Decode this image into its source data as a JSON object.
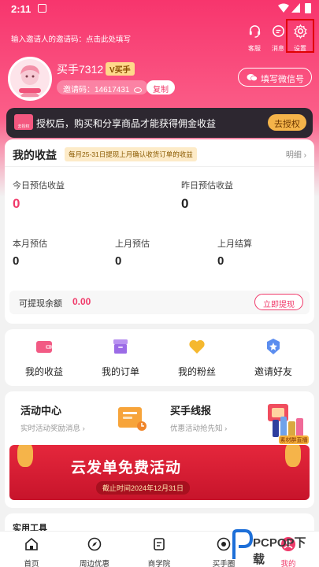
{
  "status_bar": {
    "time": "2:11"
  },
  "header": {
    "invite_tip": "输入邀请人的邀请码：点击此处填写",
    "service_label": "客服",
    "message_label": "消息",
    "settings_label": "设置"
  },
  "profile": {
    "username": "买手7312",
    "badge": "V买手",
    "invite_code_text": "邀请码：14617431",
    "copy_label": "复制",
    "wechat_label": "填写微信号"
  },
  "auth_bar": {
    "text": "授权后，购买和分享商品才能获得佣金收益",
    "button": "去授权",
    "icon_text": "去授权"
  },
  "earnings": {
    "title": "我的收益",
    "note": "每月25-31日提现上月确认收货订单的收益",
    "detail_label": "明细 ›",
    "today_label": "今日预估收益",
    "today_value": "0",
    "yesterday_label": "昨日预估收益",
    "yesterday_value": "0",
    "month_est_label": "本月预估",
    "month_est_value": "0",
    "last_month_est_label": "上月预估",
    "last_month_est_value": "0",
    "last_month_settle_label": "上月结算",
    "last_month_settle_value": "0",
    "withdrawable_label": "可提现余额",
    "withdrawable_value": "0.00",
    "withdraw_button": "立即提现"
  },
  "shortcuts": [
    {
      "label": "我的收益",
      "icon": "wallet-icon",
      "color": "#f25a84"
    },
    {
      "label": "我的订单",
      "icon": "order-box-icon",
      "color": "#9b6be6"
    },
    {
      "label": "我的粉丝",
      "icon": "heart-icon",
      "color": "#f5b82e"
    },
    {
      "label": "邀请好友",
      "icon": "star-badge-icon",
      "color": "#5b8def"
    }
  ],
  "activities": {
    "center_title": "活动中心",
    "center_sub": "实时活动奖励消息 ›",
    "report_title": "买手线报",
    "report_sub": "优惠活动抢先知 ›",
    "banner_title": "云发单免费活动",
    "banner_sub": "截止时间2024年12月31日",
    "material_tag": "素材群直播"
  },
  "tools": {
    "title": "实用工具"
  },
  "bottom_nav": [
    {
      "label": "首页",
      "icon": "home-icon"
    },
    {
      "label": "周边优惠",
      "icon": "compass-icon"
    },
    {
      "label": "商学院",
      "icon": "book-icon"
    },
    {
      "label": "买手圈",
      "icon": "circle-icon"
    },
    {
      "label": "我的",
      "icon": "profile-icon"
    }
  ],
  "watermark": {
    "text": "PCPOP下载"
  },
  "colors": {
    "brand": "#f03a6a",
    "dark_bar": "#2d2730",
    "gold": "#f5b44a"
  }
}
